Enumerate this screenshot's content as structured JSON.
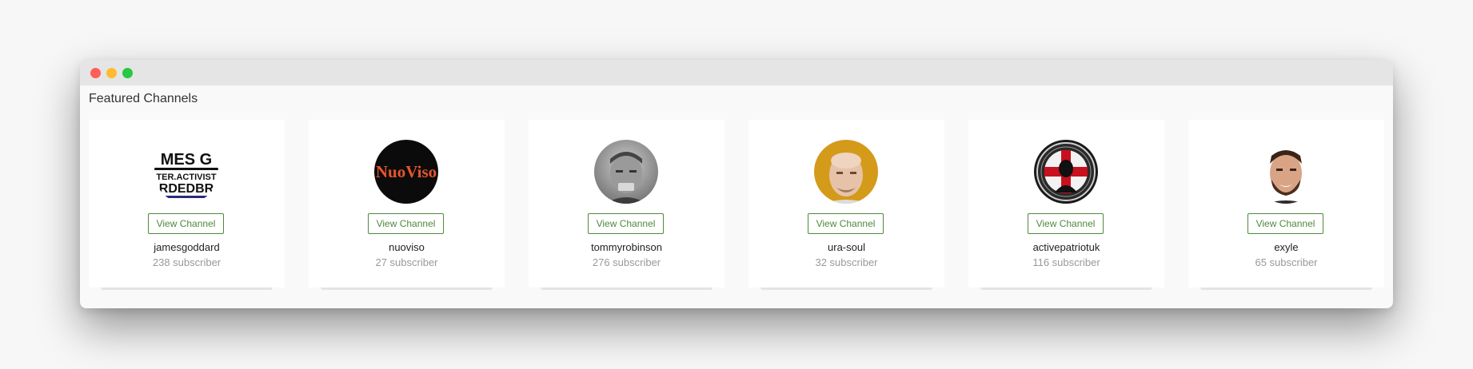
{
  "section_title": "Featured Channels",
  "view_label": "View Channel",
  "channels": [
    {
      "name": "jamesgoddard",
      "subscribers": "238 subscriber",
      "avatar_icon": "text-logo-avatar",
      "avatar_text": [
        "MES G",
        "TER.ACTIVIST",
        "RDEDBR"
      ]
    },
    {
      "name": "nuoviso",
      "subscribers": "27 subscriber",
      "avatar_icon": "nuoviso-logo-avatar",
      "avatar_text": [
        "NuoViso"
      ],
      "logo_color": "#e8542b"
    },
    {
      "name": "tommyrobinson",
      "subscribers": "276 subscriber",
      "avatar_icon": "portrait-avatar"
    },
    {
      "name": "ura-soul",
      "subscribers": "32 subscriber",
      "avatar_icon": "portrait-avatar"
    },
    {
      "name": "activepatriotuk",
      "subscribers": "116 subscriber",
      "avatar_icon": "badge-logo-avatar"
    },
    {
      "name": "exyle",
      "subscribers": "65 subscriber",
      "avatar_icon": "portrait-avatar"
    }
  ],
  "colors": {
    "accent": "#4f8a3d",
    "muted_text": "#999999",
    "traffic_red": "#fe5f57",
    "traffic_yellow": "#febc2e",
    "traffic_green": "#28c840"
  }
}
